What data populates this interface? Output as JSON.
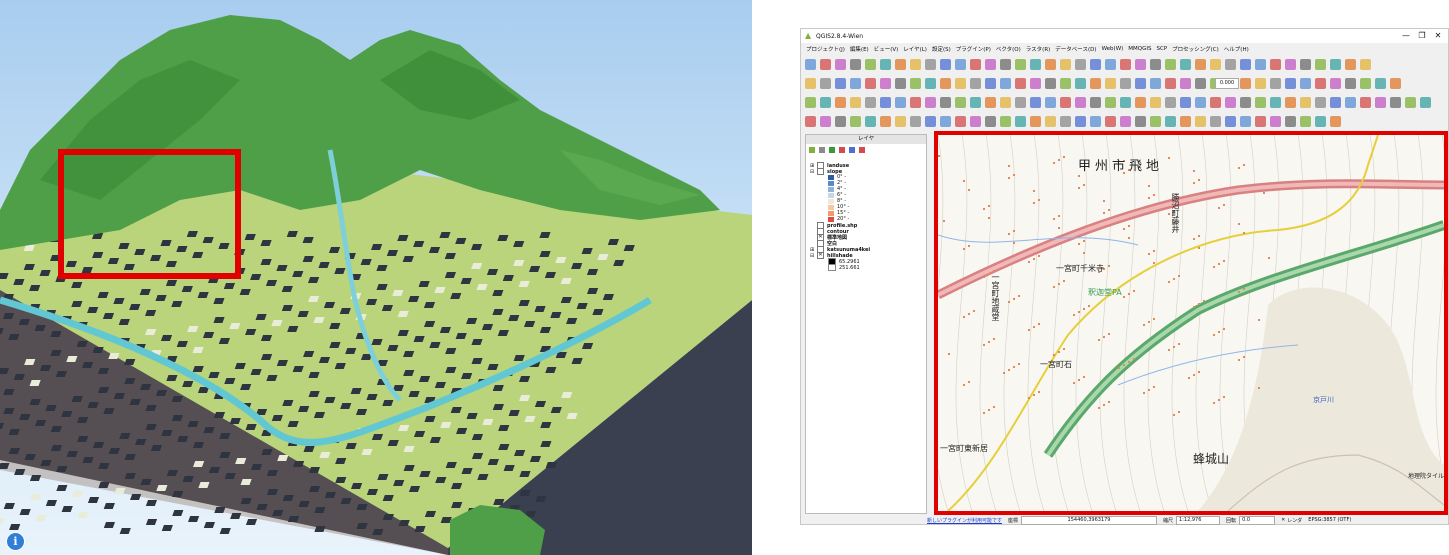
{
  "qgis": {
    "window_title": "QGIS2.8.4-Wien",
    "controls": [
      "—",
      "❐",
      "✕"
    ],
    "menu": [
      "プロジェクト(J)",
      "編集(E)",
      "ビュー(V)",
      "レイヤ(L)",
      "設定(S)",
      "プラグイン(P)",
      "ベクタ(O)",
      "ラスタ(R)",
      "データベース(D)",
      "Web(W)",
      "MMQGIS",
      "SCP",
      "プロセッシング(C)",
      "ヘルプ(H)"
    ],
    "toolbar_scale_value": "0.000",
    "layers_panel": {
      "title": "レイヤ",
      "layers": [
        {
          "name": "landuse",
          "expand": "⊞",
          "checked": false
        },
        {
          "name": "slope",
          "expand": "⊟",
          "checked": false
        },
        {
          "name": "profile.shp",
          "expand": "",
          "checked": false
        },
        {
          "name": "contour",
          "expand": "",
          "checked": false
        },
        {
          "name": "標準地図",
          "expand": "",
          "checked": true
        },
        {
          "name": "空白",
          "expand": "",
          "checked": false
        },
        {
          "name": "katsunuma4kei",
          "expand": "⊞",
          "checked": false
        },
        {
          "name": "hillshade",
          "expand": "⊟",
          "checked": true
        }
      ],
      "slope_legend": [
        {
          "label": "0° -",
          "color": "#2c5fa0"
        },
        {
          "label": "2° -",
          "color": "#5a8cc2"
        },
        {
          "label": "4° -",
          "color": "#8fb3d6"
        },
        {
          "label": "6° -",
          "color": "#c4d8ec"
        },
        {
          "label": "8° -",
          "color": "#f2e6d9"
        },
        {
          "label": "10° -",
          "color": "#f6c7a2"
        },
        {
          "label": "15° -",
          "color": "#f09a6a"
        },
        {
          "label": "20° -",
          "color": "#e04b3c"
        }
      ],
      "hillshade_legend": [
        "65.2961",
        "251.661"
      ]
    },
    "map_labels": [
      "甲州市飛地",
      "勝沼町藤井",
      "一宮町千米寺",
      "釈迦堂PA",
      "一宮町地蔵堂",
      "一宮町石",
      "一宮町東新居",
      "蜂城山",
      "京戸川",
      "地理院タイル"
    ],
    "statusbar": {
      "link_text": "新しいプラグインが利用可能です",
      "coord_label": "座標",
      "coord_value": "154460,3963179",
      "scale_label": "縮尺",
      "scale_value": "1:12,976",
      "rotation_label": "回転",
      "rotation_value": "0.0",
      "render_label": "レンダ",
      "crs": "EPSG:3857 (OTF)"
    }
  },
  "scene": {
    "info_label": "i"
  },
  "colors": {
    "highlight_red": "#e00000",
    "forest_green": "#4f9f48",
    "field_green": "#b9d47a",
    "urban_dark": "#2e3440",
    "river_cyan": "#61c7d3"
  }
}
